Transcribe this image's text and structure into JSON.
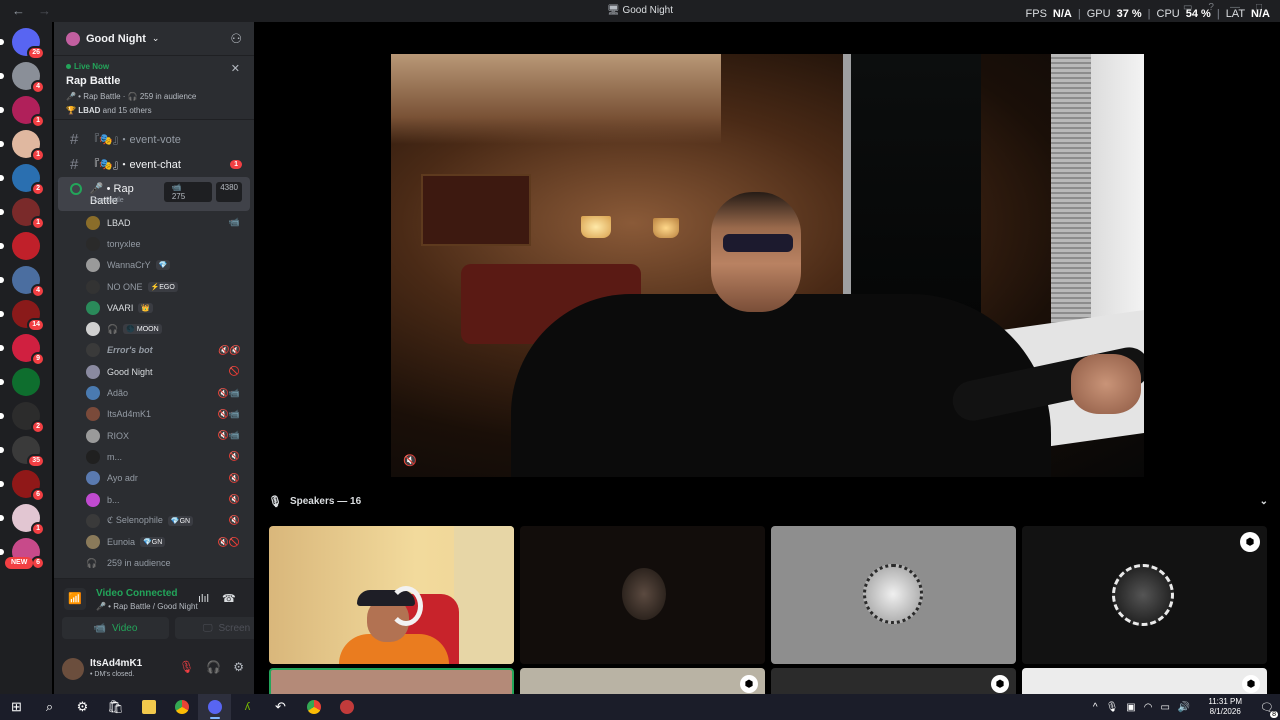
{
  "window": {
    "title": "Good Night",
    "back_icon": "arrow-left-icon",
    "forward_icon": "arrow-right-icon"
  },
  "overlay": {
    "fps_label": "FPS",
    "fps_value": "N/A",
    "gpu_label": "GPU",
    "gpu_value": "37 %",
    "cpu_label": "CPU",
    "cpu_value": "54 %",
    "lat_label": "LAT",
    "lat_value": "N/A",
    "separator": "|"
  },
  "servers": [
    {
      "badge": "26",
      "color": "#5865f2"
    },
    {
      "badge": "4",
      "color": "#8a8f98"
    },
    {
      "badge": "1",
      "color": "#b0205a"
    },
    {
      "badge": "1",
      "color": "#e0b8a0"
    },
    {
      "badge": "2",
      "color": "#2a6fb0"
    },
    {
      "badge": "1",
      "color": "#7a2a2a"
    },
    {
      "badge": "",
      "color": "#c0202a"
    },
    {
      "badge": "4",
      "color": "#4b6ea0"
    },
    {
      "badge": "14",
      "color": "#8a1a1a"
    },
    {
      "badge": "9",
      "color": "#d02040"
    },
    {
      "badge": "",
      "color": "#0e6e2e"
    },
    {
      "badge": "2",
      "color": "#2c2c2c"
    },
    {
      "badge": "35",
      "color": "#3a3a3a"
    },
    {
      "badge": "6",
      "color": "#901818"
    },
    {
      "badge": "1",
      "color": "#e2c6d2"
    },
    {
      "badge": "6",
      "color": "#c84a8a"
    }
  ],
  "new_badge": "NEW",
  "guild": {
    "name": "Good Night",
    "chevron_icon": "chevron-down-icon",
    "invite_icon": "add-user-icon"
  },
  "live_event": {
    "status": "Live Now",
    "title": "Rap Battle",
    "meta": "🎤 • Rap Battle · 🎧 259 in audience",
    "speakers_name": "LBAD",
    "speakers_suffix": " and 15 others",
    "close_icon": "close-icon"
  },
  "channels": [
    {
      "prefix": "#",
      "name": "『🎭』・event-vote",
      "badge": ""
    },
    {
      "prefix": "#",
      "name": "『🎭』・event-chat",
      "badge": "1"
    }
  ],
  "stage_channel": {
    "name": "🎤 • Rap Battle",
    "topic": "Rap Battle",
    "video_count": "275",
    "audience_count": "4380"
  },
  "members": [
    {
      "name": "LBAD",
      "tag": "",
      "icons": "📹",
      "color": "#8a6d2a"
    },
    {
      "name": "tonyxlee",
      "tag": "",
      "icons": "",
      "color": "#2a2a2a"
    },
    {
      "name": "WannaCrY",
      "tag": "💎",
      "icons": "",
      "color": "#9a9a9a"
    },
    {
      "name": "NO ONE",
      "tag": "⚡EGO",
      "icons": "",
      "color": "#333333"
    },
    {
      "name": "VAARI",
      "tag": "👑",
      "icons": "",
      "color": "#2a8a5a"
    },
    {
      "name": "🎧",
      "tag": "🌑 MOON",
      "icons": "",
      "color": "#d0d0d0"
    },
    {
      "name": "Error's bot",
      "tag": "",
      "icons": "🔇🔇",
      "color": "#3a3a3a"
    },
    {
      "name": "Good Night",
      "tag": "",
      "icons": "🚫",
      "color": "#8a8aa0"
    },
    {
      "name": "Adão",
      "tag": "",
      "icons": "🔇📹",
      "color": "#4a7ab0"
    },
    {
      "name": "ItsAd4mK1",
      "tag": "",
      "icons": "🔇📹",
      "color": "#7a4a3a"
    },
    {
      "name": "RIOX",
      "tag": "",
      "icons": "🔇📹",
      "color": "#9a9a9a"
    },
    {
      "name": "m...",
      "tag": "",
      "icons": "🔇",
      "color": "#202020"
    },
    {
      "name": "Ayo adr",
      "tag": "",
      "icons": "🔇",
      "color": "#5a7ab0"
    },
    {
      "name": "b...",
      "tag": "",
      "icons": "🔇",
      "color": "#c04ad0"
    },
    {
      "name": "ℭ Selenophile",
      "tag": "💎GN",
      "icons": "🔇",
      "color": "#3a3a3a"
    },
    {
      "name": "Eunoia",
      "tag": "💎GN",
      "icons": "🔇🚫",
      "color": "#8a7a5a"
    }
  ],
  "audience_row": "259 in audience",
  "voice": {
    "status": "Video Connected",
    "location": "🎤 • Rap Battle / Good Night",
    "video_label": "Video",
    "screen_label": "Screen",
    "signal_icon": "signal-icon",
    "wave_icon": "soundwave-icon",
    "disconnect_icon": "phone-hangup-icon"
  },
  "user": {
    "name": "ItsAd4mK1",
    "status": "• DM's closed.",
    "mute_icon": "mic-muted-icon",
    "deafen_icon": "headphones-icon",
    "settings_icon": "gear-icon"
  },
  "speakers_header": {
    "label": "Speakers — 16",
    "mic_icon": "mic-icon",
    "chevron_icon": "chevron-down-icon"
  },
  "taskbar": {
    "time": "11:31 PM",
    "date": "8/1/2026",
    "notification_count": "8"
  }
}
